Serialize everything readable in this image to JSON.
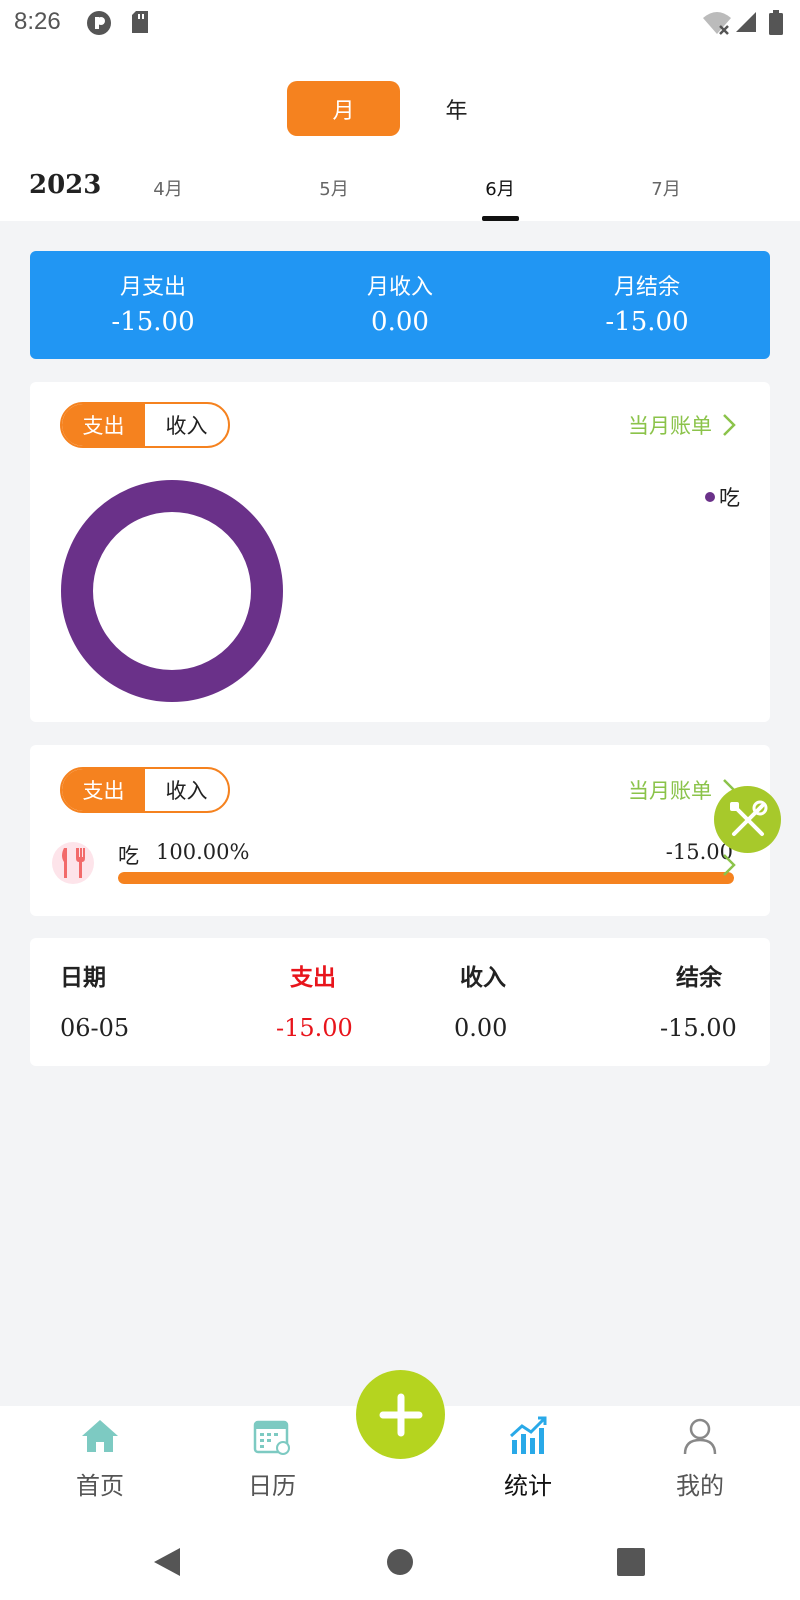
{
  "status_bar": {
    "time": "8:26"
  },
  "header": {
    "tabs": [
      {
        "label": "月"
      },
      {
        "label": "年"
      }
    ],
    "year": "2023",
    "months": [
      {
        "label": "4月"
      },
      {
        "label": "5月"
      },
      {
        "label": "6月"
      },
      {
        "label": "7月"
      }
    ],
    "selected_month": "6月"
  },
  "summary": {
    "items": [
      {
        "label": "月支出",
        "value": "-15.00"
      },
      {
        "label": "月收入",
        "value": "0.00"
      },
      {
        "label": "月结余",
        "value": "-15.00"
      }
    ]
  },
  "chart_card": {
    "toggle": {
      "expense": "支出",
      "income": "收入"
    },
    "bill_link": "当月账单",
    "legend": [
      {
        "label": "吃",
        "color": "#6a3189"
      }
    ]
  },
  "chart_data": {
    "type": "pie",
    "donut": true,
    "categories": [
      "吃"
    ],
    "values": [
      15.0
    ],
    "colors": [
      "#6a3189"
    ]
  },
  "category_card": {
    "toggle": {
      "expense": "支出",
      "income": "收入"
    },
    "bill_link": "当月账单",
    "rows": [
      {
        "icon": "fork-knife-icon",
        "label": "吃",
        "percent": "100.00%",
        "amount": "-15.00",
        "fill_fraction": 1.0
      }
    ]
  },
  "daily_table": {
    "headers": {
      "date": "日期",
      "expense": "支出",
      "income": "收入",
      "balance": "结余"
    },
    "rows": [
      {
        "date": "06-05",
        "expense": "-15.00",
        "income": "0.00",
        "balance": "-15.00"
      }
    ],
    "expense_color": "#e8141b"
  },
  "bottom_nav": {
    "items": [
      {
        "label": "首页",
        "icon": "home-icon"
      },
      {
        "label": "日历",
        "icon": "calendar-icon"
      },
      {
        "label": "统计",
        "icon": "chart-icon",
        "active": true
      },
      {
        "label": "我的",
        "icon": "user-icon"
      }
    ]
  },
  "colors": {
    "accent": "#f5821f",
    "summary_bg": "#2196f3",
    "link_green": "#8bc34a",
    "fab_green": "#b5d41f"
  }
}
